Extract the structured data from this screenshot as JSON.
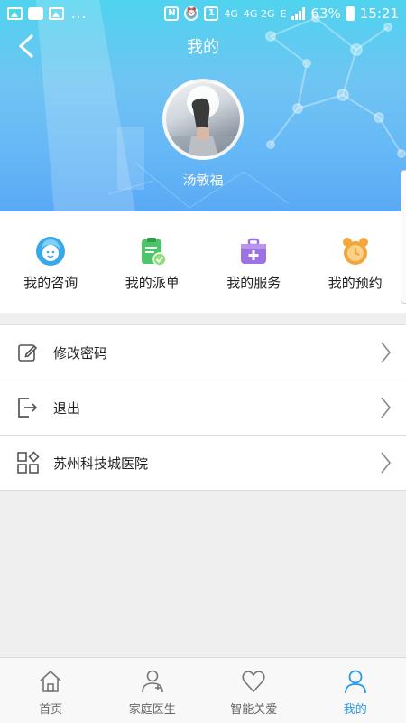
{
  "status_bar": {
    "dots": "...",
    "sim_badge": "1",
    "net_4g": "4G",
    "net_4g2g": "4G 2G",
    "net_e": "E",
    "battery": "63%",
    "time": "15:21"
  },
  "header": {
    "title": "我的",
    "username": "汤敏福"
  },
  "quick_actions": [
    {
      "label": "我的咨询",
      "icon": "consult-person-icon",
      "color": "#3aa8e8"
    },
    {
      "label": "我的派单",
      "icon": "dispatch-clipboard-icon",
      "color": "#4cc46a"
    },
    {
      "label": "我的服务",
      "icon": "service-medkit-icon",
      "color": "#9d72e2"
    },
    {
      "label": "我的预约",
      "icon": "alarm-clock-icon",
      "color": "#f3a73a"
    }
  ],
  "menu": [
    {
      "label": "修改密码",
      "icon": "edit-pencil-icon"
    },
    {
      "label": "退出",
      "icon": "logout-icon"
    },
    {
      "label": "苏州科技城医院",
      "icon": "apps-grid-icon"
    }
  ],
  "tabs": [
    {
      "label": "首页",
      "icon": "home-icon",
      "active": false
    },
    {
      "label": "家庭医生",
      "icon": "doctor-icon",
      "active": false
    },
    {
      "label": "智能关爱",
      "icon": "heart-icon",
      "active": false
    },
    {
      "label": "我的",
      "icon": "user-icon",
      "active": true
    }
  ],
  "colors": {
    "header_top": "#4fd3ee",
    "header_bottom": "#5aa9f5",
    "accent": "#2a9ae0",
    "background": "#efefef"
  }
}
